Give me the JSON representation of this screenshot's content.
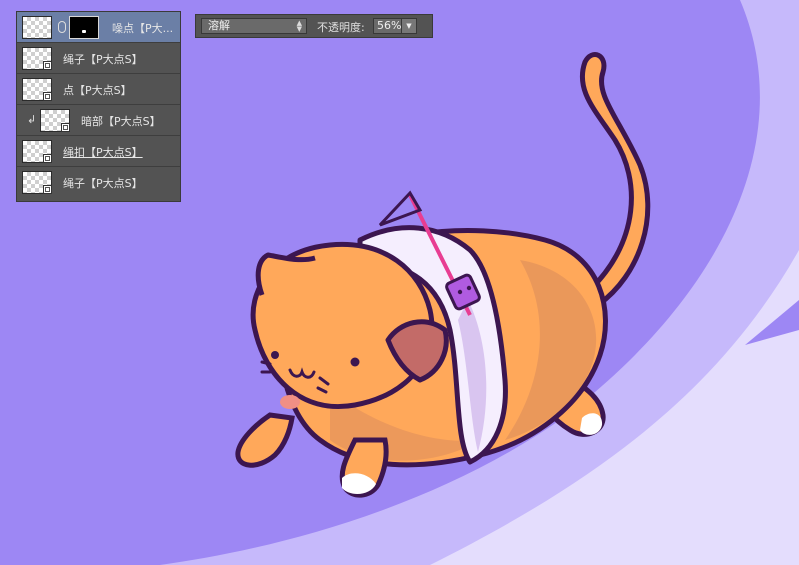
{
  "layers_panel": {
    "layers": [
      {
        "name": "噪点【P大...",
        "selected": true,
        "has_mask": true,
        "clipped": false
      },
      {
        "name": "绳子【P大点S】",
        "selected": false,
        "has_mask": false,
        "clipped": false
      },
      {
        "name": "点【P大点S】",
        "selected": false,
        "has_mask": false,
        "clipped": false
      },
      {
        "name": "暗部【P大点S】",
        "selected": false,
        "has_mask": false,
        "clipped": true
      },
      {
        "name": "绳扣【P大点S】",
        "selected": false,
        "has_mask": false,
        "clipped": false
      },
      {
        "name": "绳子【P大点S】",
        "selected": false,
        "has_mask": false,
        "clipped": false
      }
    ]
  },
  "blend_bar": {
    "mode": "溶解",
    "opacity_label": "不透明度:",
    "opacity_value": "56%"
  },
  "colors": {
    "background": "#9d87f4",
    "cat_body": "#ffa85a",
    "outline": "#3c1650",
    "scarf": "#f5eefe",
    "accent": "#e83d92"
  }
}
